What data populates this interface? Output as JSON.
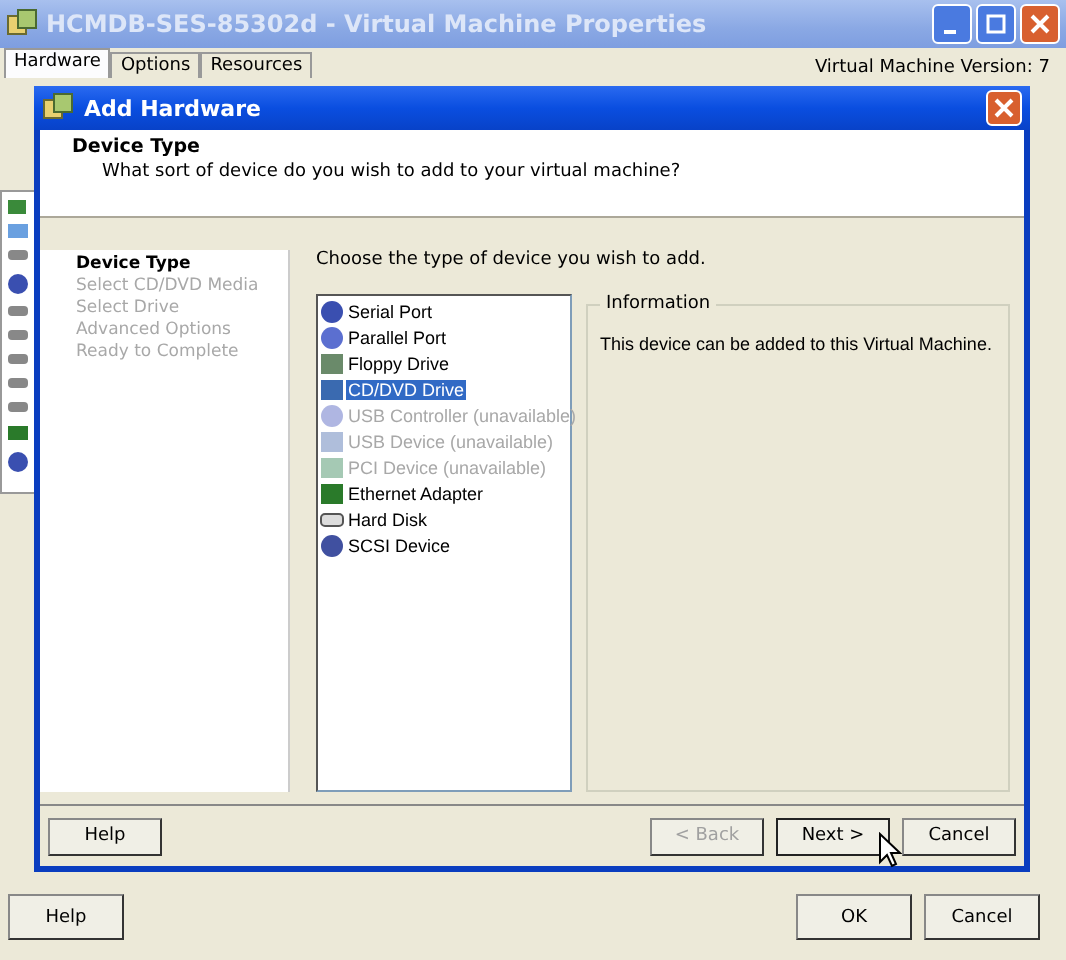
{
  "window": {
    "title": "HCMDB-SES-85302d - Virtual Machine Properties"
  },
  "tabs": [
    {
      "label": "Hardware",
      "selected": true
    },
    {
      "label": "Options",
      "selected": false
    },
    {
      "label": "Resources",
      "selected": false
    }
  ],
  "version": "Virtual Machine Version: 7",
  "dialog": {
    "title": "Add Hardware",
    "heading": "Device Type",
    "subheading": "What sort of device do you wish to add to your virtual machine?",
    "steps": [
      {
        "label": "Device Type",
        "selected": true
      },
      {
        "label": "Select CD/DVD Media",
        "selected": false
      },
      {
        "label": "Select Drive",
        "selected": false
      },
      {
        "label": "Advanced Options",
        "selected": false
      },
      {
        "label": "Ready to Complete",
        "selected": false
      }
    ],
    "prompt": "Choose the type of device you wish to add.",
    "devices": [
      {
        "label": "Serial Port",
        "kind": "serial",
        "disabled": false,
        "selected": false
      },
      {
        "label": "Parallel Port",
        "kind": "parallel",
        "disabled": false,
        "selected": false
      },
      {
        "label": "Floppy Drive",
        "kind": "floppy",
        "disabled": false,
        "selected": false
      },
      {
        "label": "CD/DVD Drive",
        "kind": "cdrom",
        "disabled": false,
        "selected": true
      },
      {
        "label": "USB Controller (unavailable)",
        "kind": "usb",
        "disabled": true,
        "selected": false
      },
      {
        "label": "USB Device (unavailable)",
        "kind": "usbdevice",
        "disabled": true,
        "selected": false
      },
      {
        "label": "PCI Device (unavailable)",
        "kind": "pci",
        "disabled": true,
        "selected": false
      },
      {
        "label": "Ethernet Adapter",
        "kind": "ethernet",
        "disabled": false,
        "selected": false
      },
      {
        "label": "Hard Disk",
        "kind": "disk",
        "disabled": false,
        "selected": false
      },
      {
        "label": "SCSI Device",
        "kind": "scsi",
        "disabled": false,
        "selected": false
      }
    ],
    "info": {
      "title": "Information",
      "text": "This device can be added to this Virtual Machine."
    },
    "help": "Help",
    "buttons": [
      {
        "label": "< Back",
        "disabled": true
      },
      {
        "label": "Next >",
        "disabled": false
      },
      {
        "label": "Cancel",
        "disabled": false
      }
    ]
  },
  "footer": {
    "help": "Help",
    "buttons": [
      "OK",
      "Cancel"
    ]
  }
}
